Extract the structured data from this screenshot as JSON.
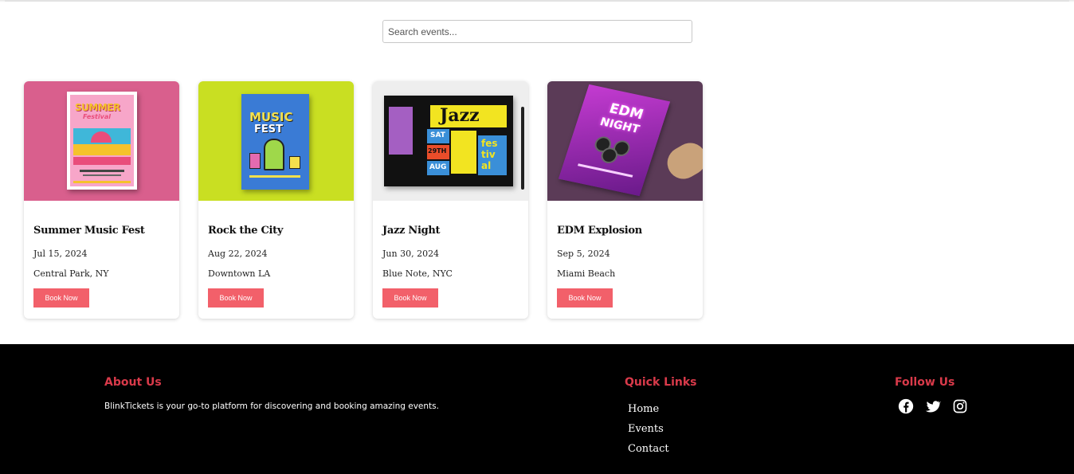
{
  "search": {
    "placeholder": "Search events..."
  },
  "events": [
    {
      "title": "Summer Music Fest",
      "date": "Jul 15, 2024",
      "venue": "Central Park, NY",
      "button": "Book Now",
      "poster_text": [
        "SUMMER",
        "Festival"
      ],
      "bg_color": "#d95f8d"
    },
    {
      "title": "Rock the City",
      "date": "Aug 22, 2024",
      "venue": "Downtown LA",
      "button": "Book Now",
      "poster_text": [
        "MUSIC",
        "FEST"
      ],
      "bg_color": "#c9df22"
    },
    {
      "title": "Jazz Night",
      "date": "Jun 30, 2024",
      "venue": "Blue Note, NYC",
      "button": "Book Now",
      "poster_text": [
        "Jazz",
        "SAT",
        "29TH",
        "AUG",
        "fes",
        "tiv",
        "al"
      ],
      "bg_color": "#eeeeee"
    },
    {
      "title": "EDM Explosion",
      "date": "Sep 5, 2024",
      "venue": "Miami Beach",
      "button": "Book Now",
      "poster_text": [
        "EDM",
        "NIGHT"
      ],
      "bg_color": "#5b3b57"
    }
  ],
  "footer": {
    "about": {
      "heading": "About Us",
      "text": "BlinkTickets is your go-to platform for discovering and booking amazing events."
    },
    "quick_links": {
      "heading": "Quick Links",
      "items": [
        "Home",
        "Events",
        "Contact"
      ]
    },
    "follow": {
      "heading": "Follow Us",
      "icons": [
        "facebook-icon",
        "twitter-icon",
        "instagram-icon"
      ]
    },
    "accent_color": "#d93a4a"
  },
  "colors": {
    "button": "#f2606a"
  }
}
